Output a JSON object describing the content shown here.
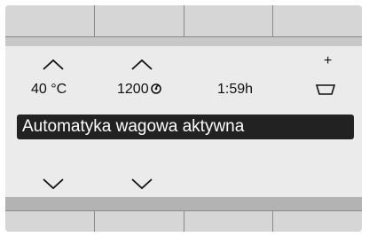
{
  "display": {
    "temperature": "40 °C",
    "spin_speed": "1200",
    "duration": "1:59h",
    "status_message": "Automatyka wagowa aktywna",
    "plus_symbol": "+"
  },
  "icons": {
    "temperature_up": "chevron-up-icon",
    "spin_up": "chevron-up-icon",
    "temperature_down": "chevron-down-icon",
    "spin_down": "chevron-down-icon",
    "spin": "spin-icon",
    "detergent": "detergent-container-icon"
  },
  "colors": {
    "status_bar_bg": "#222222",
    "status_bar_text": "#ffffff",
    "screen_bg": "#ebebeb"
  }
}
